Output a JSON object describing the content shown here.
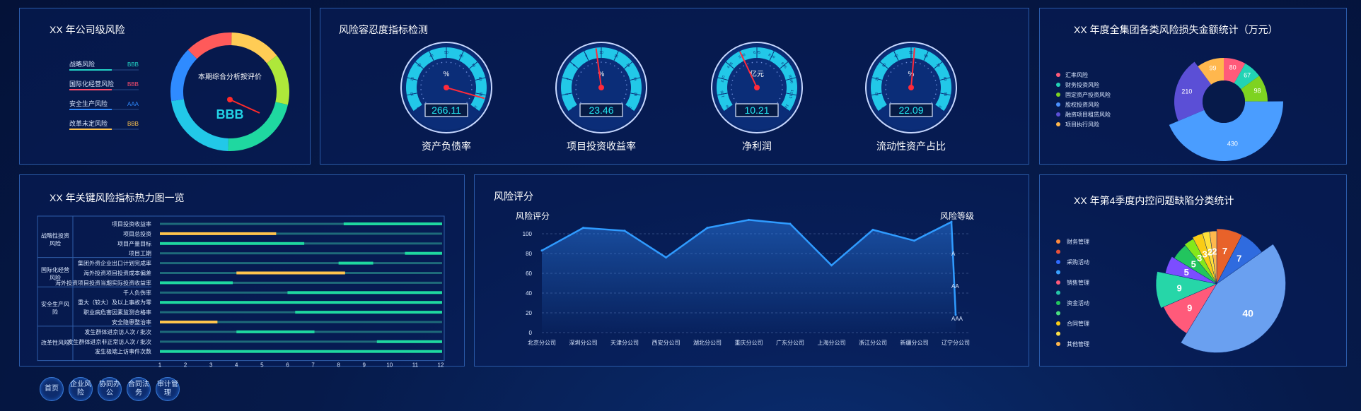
{
  "panels": {
    "risk_company": {
      "title": "XX 年公司级风险",
      "rows": [
        {
          "label": "战略风险",
          "level": "BBB",
          "color": "#22d3c5"
        },
        {
          "label": "国际化经营风险",
          "level": "BBB",
          "color": "#ff4d6d"
        },
        {
          "label": "安全生产风险",
          "level": "AAA",
          "color": "#2f8bff"
        },
        {
          "label": "改革未定风险",
          "level": "BBB",
          "color": "#ffc44d"
        }
      ],
      "center_label": "本期综合分析按评价",
      "center_value": "BBB",
      "ring_segments": [
        {
          "color": "#ff5a5a",
          "value": 13
        },
        {
          "color": "#ffcc55",
          "value": 14
        },
        {
          "color": "#aee83a",
          "value": 14
        },
        {
          "color": "#1fd8a0",
          "value": 22
        },
        {
          "color": "#22c8e8",
          "value": 22
        },
        {
          "color": "#2f8bff",
          "value": 15
        }
      ]
    },
    "tolerance": {
      "title": "风险容忍度指标检测",
      "gauges": [
        {
          "name": "资产负债率",
          "value": "266.11",
          "unit": "%",
          "needle": 0.92,
          "ticks": [
            "0",
            "10",
            "20",
            "30",
            "40",
            "50",
            "60",
            "70",
            "80",
            "90",
            "100"
          ]
        },
        {
          "name": "项目投资收益率",
          "value": "23.46",
          "unit": "%",
          "needle": 0.47,
          "ticks": [
            "0",
            "2",
            "4",
            "6",
            "8",
            "10",
            "12",
            "14",
            "16",
            "18",
            "20"
          ]
        },
        {
          "name": "净利润",
          "value": "10.21",
          "unit": "亿元",
          "needle": 0.4,
          "ticks": [
            "0.00",
            "1.35",
            "2.70",
            "4.05",
            "5.40",
            "6.75",
            "8.10",
            "9.45",
            "10.80",
            "12.15",
            "13.50"
          ]
        },
        {
          "name": "流动性资产占比",
          "value": "22.09",
          "unit": "%",
          "needle": 0.52,
          "ticks": [
            "0",
            "10",
            "20",
            "30",
            "40",
            "50",
            "60",
            "70",
            "80",
            "90",
            "100"
          ]
        }
      ]
    },
    "loss_stats": {
      "title": "XX 年度全集团各类风险损失金额统计（万元）",
      "legend": [
        {
          "label": "汇率风险",
          "color": "#ff5a7a"
        },
        {
          "label": "财务投资风险",
          "color": "#22d3b5"
        },
        {
          "label": "固定资产投资风险",
          "color": "#7ed321"
        },
        {
          "label": "股权投资风险",
          "color": "#4a90ff"
        },
        {
          "label": "融资项目租赁风险",
          "color": "#5b4fd6"
        },
        {
          "label": "项目执行风险",
          "color": "#ffb74d"
        }
      ],
      "slices": [
        {
          "value": 80,
          "color": "#ff5a7a",
          "label": "80"
        },
        {
          "value": 67,
          "color": "#22d3b5",
          "label": "67"
        },
        {
          "value": 98,
          "color": "#7ed321",
          "label": "98"
        },
        {
          "value": 430,
          "color": "#4a9dff",
          "label": "430"
        },
        {
          "value": 210,
          "color": "#5b4fd6",
          "label": "210"
        },
        {
          "value": 99,
          "color": "#ffb74d",
          "label": "99"
        }
      ]
    },
    "heatmap": {
      "title": "XX 年关键风险指标热力图一览",
      "groups": [
        {
          "name": "战略性投资风险",
          "rows": [
            "项目投资收益率",
            "项目总投资",
            "项目产量目标",
            "项目工期"
          ]
        },
        {
          "name": "国际化经营风险",
          "rows": [
            "集团外资企业出口计划完成率",
            "海外投资项目投资成本偏差",
            "海外投资项目投资当期实际投资收益率"
          ]
        },
        {
          "name": "安全生产风险",
          "rows": [
            "千人负伤率",
            "重大（较大）及以上事故为零",
            "职业病危害因素监测合格率",
            "安全隐患整治率"
          ]
        },
        {
          "name": "改革性风险",
          "rows": [
            "发生群体进京访人次 / 批次",
            "发生群体进京非正常访人次 / 批次",
            "发生极端上访事件次数"
          ]
        }
      ],
      "bars": [
        {
          "start": 8.2,
          "end": 12,
          "color": "#1fd8a0"
        },
        {
          "start": 1,
          "end": 5.5,
          "color": "#ffc44d"
        },
        {
          "start": 1,
          "end": 6.6,
          "color": "#1fd8a0"
        },
        {
          "start": 10.6,
          "end": 12,
          "color": "#1fd8a0"
        },
        {
          "start": 8,
          "end": 9.3,
          "color": "#1fd8a0"
        },
        {
          "start": 4,
          "end": 8.2,
          "color": "#ffc44d"
        },
        {
          "start": 1,
          "end": 3.8,
          "color": "#1fd8a0"
        },
        {
          "start": 6,
          "end": 12,
          "color": "#1fd8a0"
        },
        {
          "start": 1,
          "end": 12,
          "color": "#1fd8a0"
        },
        {
          "start": 6.3,
          "end": 12,
          "color": "#1fd8a0"
        },
        {
          "start": 1,
          "end": 3.2,
          "color": "#ffc44d"
        },
        {
          "start": 4,
          "end": 7,
          "color": "#1fd8a0"
        },
        {
          "start": 9.5,
          "end": 12,
          "color": "#1fd8a0"
        },
        {
          "start": 1,
          "end": 12,
          "color": "#1fd8a0"
        }
      ],
      "xticks": [
        "1",
        "2",
        "3",
        "4",
        "5",
        "6",
        "7",
        "8",
        "9",
        "10",
        "11",
        "12"
      ]
    },
    "risk_score": {
      "title": "风险评分",
      "ylabel_left": "风险评分",
      "ylabel_right": "风险等级",
      "right_levels": [
        "A",
        "AA",
        "AAA"
      ]
    },
    "defects": {
      "title": "XX 年第4季度内控问题缺陷分类统计",
      "legend": [
        {
          "label": "财务管理",
          "color": "#ff8a3d"
        },
        {
          "label": "",
          "color": "#e8523a"
        },
        {
          "label": "采购活动",
          "color": "#2f6bff"
        },
        {
          "label": "",
          "color": "#3aa0ff"
        },
        {
          "label": "销售管理",
          "color": "#ff5a7a"
        },
        {
          "label": "",
          "color": "#26c6a8"
        },
        {
          "label": "资金活动",
          "color": "#22c55e"
        },
        {
          "label": "",
          "color": "#4ade80"
        },
        {
          "label": "合同管理",
          "color": "#facc15"
        },
        {
          "label": "",
          "color": "#fde047"
        },
        {
          "label": "其他管理",
          "color": "#ffb74d"
        }
      ],
      "slices": [
        {
          "value": 7,
          "color": "#e8622a",
          "label": "7",
          "r": 1.0
        },
        {
          "value": 7,
          "color": "#2f6bdf",
          "label": "7",
          "r": 1.0
        },
        {
          "value": 40,
          "color": "#6aa0f0",
          "label": "40",
          "r": 1.25
        },
        {
          "value": 9,
          "color": "#ff5a7a",
          "label": "9",
          "r": 1.05
        },
        {
          "value": 9,
          "color": "#26d6a8",
          "label": "9",
          "r": 1.1
        },
        {
          "value": 5,
          "color": "#7c4dff",
          "label": "5",
          "r": 0.95
        },
        {
          "value": 5,
          "color": "#22c55e",
          "label": "5",
          "r": 0.9
        },
        {
          "value": 3,
          "color": "#84e81a",
          "label": "3",
          "r": 0.92
        },
        {
          "value": 3,
          "color": "#facc15",
          "label": "3",
          "r": 0.95
        },
        {
          "value": 2,
          "color": "#ffe03a",
          "label": "2",
          "r": 0.96
        },
        {
          "value": 2,
          "color": "#ffb84d",
          "label": "2",
          "r": 0.96
        }
      ]
    }
  },
  "chart_data": {
    "type": "line",
    "title": "风险评分",
    "xlabel": "",
    "ylabel": "风险评分",
    "categories": [
      "北京分公司",
      "深圳分公司",
      "天津分公司",
      "西安分公司",
      "湖北分公司",
      "重庆分公司",
      "广东分公司",
      "上海分公司",
      "浙江分公司",
      "新疆分公司",
      "辽宁分公司"
    ],
    "series": [
      {
        "values": [
          83,
          106,
          103,
          76,
          106,
          114,
          110,
          68,
          104,
          93,
          112,
          18
        ]
      }
    ],
    "yticks": [
      "0",
      "20",
      "40",
      "60",
      "80",
      "100"
    ],
    "ylim": [
      0,
      120
    ],
    "grid": true
  },
  "nav": {
    "buttons": [
      "首页",
      "企业风险",
      "协同办公",
      "合同法务",
      "审计管理"
    ]
  }
}
